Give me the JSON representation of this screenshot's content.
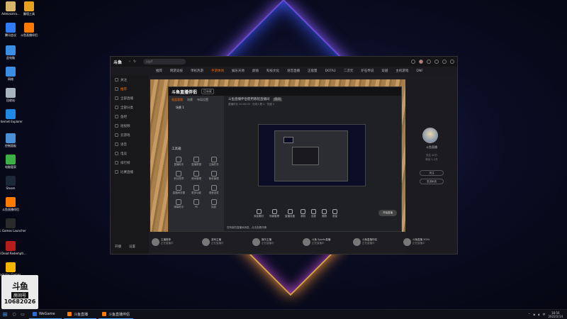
{
  "desktop": {
    "icons": [
      {
        "label": "Administra...",
        "color": "#d8b36a"
      },
      {
        "label": "翻墙工具",
        "color": "#e8a020"
      },
      {
        "label": "腾讯会议",
        "color": "#2f7cf6"
      },
      {
        "label": "斗鱼直播伴侣",
        "color": "#ff7a00"
      },
      {
        "label": "此电脑",
        "color": "#3a8ee6"
      },
      {
        "label": "网络",
        "color": "#3a8ee6"
      },
      {
        "label": "回收站",
        "color": "#aab4c0"
      },
      {
        "label": "Internet Explorer",
        "color": "#1e88e5"
      },
      {
        "label": "控制面板",
        "color": "#4a90d9"
      },
      {
        "label": "电脑管家",
        "color": "#3cb043"
      },
      {
        "label": "Steam",
        "color": "#1b2838"
      },
      {
        "label": "斗鱼直播伴侣",
        "color": "#ff7a00"
      },
      {
        "label": "Epic Games Launcher",
        "color": "#2a2a2a"
      },
      {
        "label": "Red Dead Redempti...",
        "color": "#b71c1c"
      },
      {
        "label": "Rockstar Games...",
        "color": "#f5b400"
      }
    ],
    "logo": {
      "mark": "斗鱼",
      "sub": "房间号",
      "number": "10682026"
    }
  },
  "app": {
    "brand": "斗鱼",
    "search_placeholder": "pypf",
    "nav": [
      "推荐",
      "网游竞技",
      "单机热游",
      "手游休闲",
      "娱乐天地",
      "颜值",
      "科技文化",
      "语音直播",
      "正能量"
    ],
    "nav_extra": [
      "DOTA2",
      "二次元",
      "炉石传说",
      "穿越",
      "主机游戏",
      "DNF"
    ],
    "nav_active_index": 3,
    "sidebar": [
      {
        "label": "关注"
      },
      {
        "label": "推荐"
      },
      {
        "label": "全部直播"
      },
      {
        "label": "全部分类"
      },
      {
        "label": "鱼吧"
      },
      {
        "label": "短视频"
      },
      {
        "label": "云游戏"
      },
      {
        "label": "语音"
      },
      {
        "label": "电竞"
      },
      {
        "label": "排行榜"
      },
      {
        "label": "比赛直播"
      }
    ],
    "sidebar_active_index": 1,
    "sidebar_footer": [
      "开播",
      "设置"
    ]
  },
  "inner_app": {
    "title": "斗鱼直播伴侣",
    "badge": "已认证",
    "tabs": [
      "画面管理",
      "场景",
      "布局设置"
    ],
    "tabs_active_index": 0,
    "scene": "场景 1",
    "tools_title": "工具箱",
    "tools": [
      "直播助手",
      "直播数据",
      "主播任务",
      "粉丝勋章",
      "房间管理",
      "营收管理",
      "直播间设置",
      "更多功能",
      "语音连麦",
      "弹幕助手",
      "PK",
      "抽奖"
    ],
    "room_title": "斗鱼直播伴侣使用教程直播间",
    "room_tag": "房间",
    "room_meta": "直播时长 00:00:00  ·  在线人数 0  ·  热度 0",
    "controls": [
      "添加素材",
      "场景管理",
      "直播设置",
      "录制",
      "连麦",
      "美颜",
      "音量"
    ],
    "start_label": "开始直播",
    "notice": "您有新的直播间消息，点击查看详情"
  },
  "right_panel": {
    "name": "斗鱼直播",
    "stats": [
      "关注 20万",
      "粉丝 1.2万"
    ],
    "follow_label": "关注",
    "message_label": "发送私信"
  },
  "anchors": [
    {
      "name": "主播推荐",
      "sub": "正在直播中"
    },
    {
      "name": "游戏主播",
      "sub": "正在直播中"
    },
    {
      "name": "娱乐主播",
      "sub": "正在直播中"
    },
    {
      "name": "斗鱼 Sports直播",
      "sub": "正在直播中"
    },
    {
      "name": "斗鱼直播伴侣",
      "sub": "正在直播中"
    },
    {
      "name": "斗鱼直播 2024",
      "sub": "正在直播中"
    }
  ],
  "taskbar": {
    "apps": [
      {
        "label": "WeGame",
        "color": "#2a6bd6"
      },
      {
        "label": "斗鱼直播",
        "color": "#ff7a00"
      },
      {
        "label": "斗鱼直播伴侣",
        "color": "#ff7a00"
      }
    ],
    "time": "18:56",
    "date": "2022/2/14",
    "tray": "中"
  },
  "colors": {
    "accent": "#ff6a00",
    "taskbar_highlight": "#4aa3ff"
  }
}
